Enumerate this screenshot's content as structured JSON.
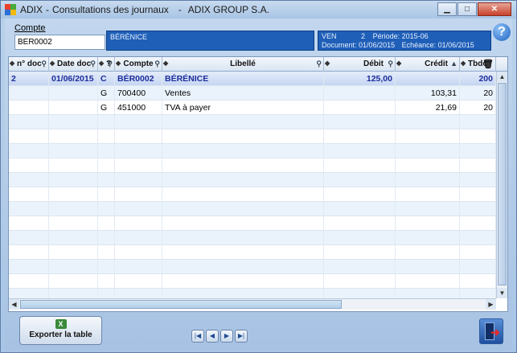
{
  "window": {
    "app_name": "ADIX",
    "separator_1": "-",
    "subtitle": "Consultations des journaux",
    "separator_2": "-",
    "company": "ADIX GROUP S.A.",
    "minimize": "▁",
    "maximize": "□",
    "close": "✕"
  },
  "compte": {
    "label": "Compte",
    "value": "BÉR0002"
  },
  "info": {
    "name": "BÉRÉNICE",
    "journal": "VEN",
    "number": "2",
    "periode_label": "Période:",
    "periode": "2015-06",
    "document_label": "Document:",
    "document_date": "01/06/2015",
    "echeance_label": "Echéance:",
    "echeance_date": "01/06/2015"
  },
  "grid": {
    "columns": [
      {
        "label": "n° doc"
      },
      {
        "label": "Date doc"
      },
      {
        "label": "?"
      },
      {
        "label": "Compte"
      },
      {
        "label": "Libellé"
      },
      {
        "label": "Débit"
      },
      {
        "label": "Crédit"
      },
      {
        "label": "Tbdc"
      }
    ],
    "rows": [
      [
        "2",
        "01/06/2015",
        "C",
        "BÉR0002",
        "BÉRÉNICE",
        "125,00",
        "",
        "200"
      ],
      [
        "",
        "",
        "G",
        "700400",
        "Ventes",
        "",
        "103,31",
        "20"
      ],
      [
        "",
        "",
        "G",
        "451000",
        "TVA à payer",
        "",
        "21,69",
        "20"
      ]
    ],
    "empty_rows": 13
  },
  "footer": {
    "export_label": "Exporter la table",
    "nav": [
      "|◀",
      "◀",
      "▶",
      "▶|"
    ]
  },
  "icons": {
    "help": "?",
    "excel": "X",
    "trash": "🗑",
    "exit_arrow": "➜",
    "mag": "⚲",
    "dot": "◆",
    "sort_up": "▲",
    "scroll_up": "▲",
    "scroll_down": "▼",
    "scroll_left": "◀",
    "scroll_right": "▶"
  }
}
